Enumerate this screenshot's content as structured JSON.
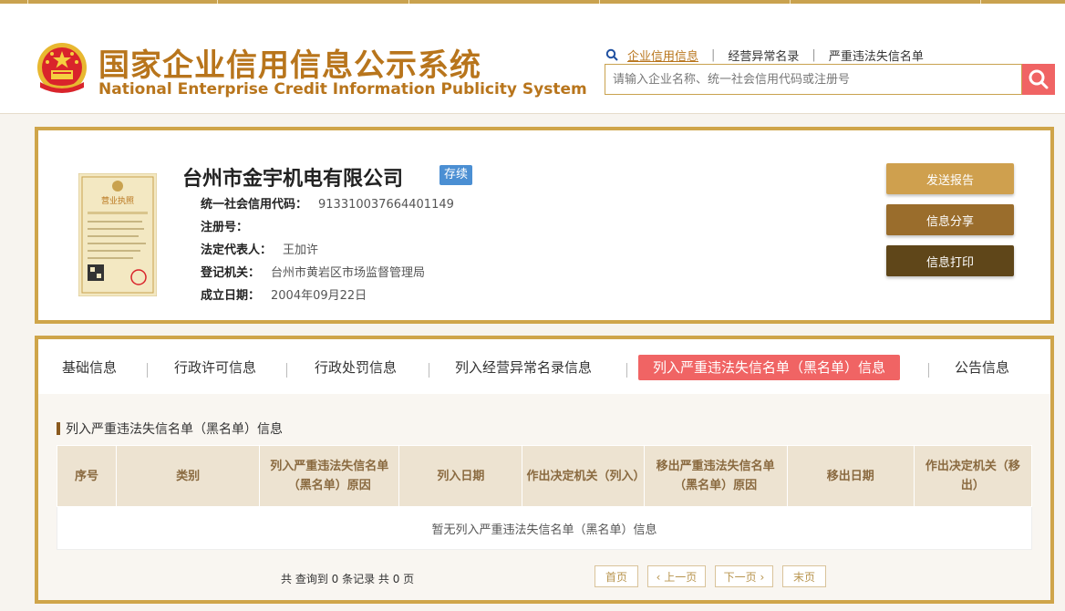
{
  "site": {
    "title_cn": "国家企业信用信息公示系统",
    "title_en": "National Enterprise Credit Information Publicity System"
  },
  "nav": {
    "links": [
      "企业信用信息",
      "经营异常名录",
      "严重违法失信名单"
    ],
    "search_placeholder": "请输入企业名称、统一社会信用代码或注册号"
  },
  "company": {
    "name": "台州市金宇机电有限公司",
    "status": "存续",
    "fields": [
      {
        "label": "统一社会信用代码：",
        "value": "913310037664401149"
      },
      {
        "label": "注册号：",
        "value": ""
      },
      {
        "label": "法定代表人：",
        "value": "王加许"
      },
      {
        "label": "登记机关：",
        "value": "台州市黄岩区市场监督管理局"
      },
      {
        "label": "成立日期：",
        "value": "2004年09月22日"
      }
    ],
    "license_text": "营业执照",
    "buttons": [
      "发送报告",
      "信息分享",
      "信息打印"
    ]
  },
  "tabs": [
    "基础信息",
    "行政许可信息",
    "行政处罚信息",
    "列入经营异常名录信息",
    "列入严重违法失信名单（黑名单）信息",
    "公告信息"
  ],
  "section": {
    "title": "列入严重违法失信名单（黑名单）信息",
    "columns": [
      "序号",
      "类别",
      "列入严重违法失信名单（黑名单）原因",
      "列入日期",
      "作出决定机关（列入）",
      "移出严重违法失信名单（黑名单）原因",
      "移出日期",
      "作出决定机关（移出）"
    ],
    "empty_text": "暂无列入严重违法失信名单（黑名单）信息"
  },
  "pager": {
    "info": "共 查询到 0 条记录 共 0 页",
    "first": "首页",
    "prev": "上一页",
    "next": "下一页",
    "last": "末页"
  },
  "colors": {
    "gold": "#cfa54a",
    "brand_text": "#b8751c",
    "accent_red": "#f06464",
    "status_blue": "#4b8fd3"
  }
}
